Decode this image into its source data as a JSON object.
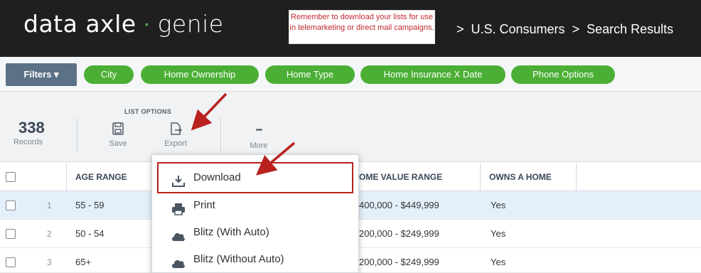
{
  "header": {
    "logo_main": "data axle",
    "logo_dot": "·",
    "logo_sub": "genie",
    "notice": "Remember to download your lists for use in telemarketing or direct mail campaigns.",
    "breadcrumb": [
      ">",
      "U.S. Consumers",
      ">",
      "Search Results"
    ]
  },
  "filters": {
    "button_label": "Filters ▾",
    "chips": [
      "City",
      "Home Ownership",
      "Home Type",
      "Home Insurance X Date",
      "Phone Options"
    ]
  },
  "toolbar": {
    "count": "338",
    "count_label": "Records",
    "list_options_label": "LIST OPTIONS",
    "save_label": "Save",
    "export_label": "Export",
    "more_label": "More",
    "more_glyph": "•••"
  },
  "table": {
    "headers": [
      "AGE RANGE",
      "OME VALUE RANGE",
      "OWNS A HOME"
    ],
    "rows": [
      {
        "num": "1",
        "age": "55 - 59",
        "value": "400,000 - $449,999",
        "owns": "Yes"
      },
      {
        "num": "2",
        "age": "50 - 54",
        "value": "200,000 - $249,999",
        "owns": "Yes"
      },
      {
        "num": "3",
        "age": "65+",
        "value": "200,000 - $249,999",
        "owns": "Yes"
      }
    ]
  },
  "export_menu": {
    "items": [
      "Download",
      "Print",
      "Blitz (With Auto)",
      "Blitz (Without Auto)"
    ]
  },
  "colors": {
    "header_bg": "#1f1f1f",
    "chip_green": "#4caf35",
    "filters_btn": "#5b7185",
    "annotation_red": "#b8211e",
    "row_highlight": "#e3f0fb"
  }
}
